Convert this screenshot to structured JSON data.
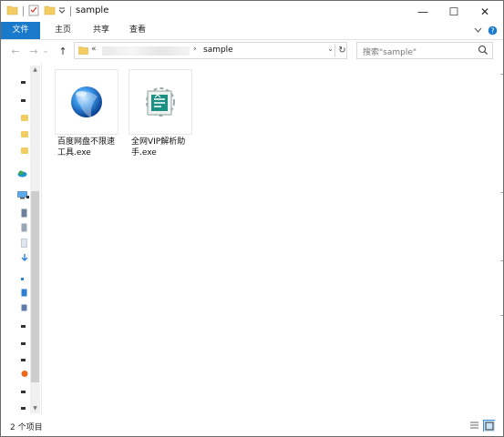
{
  "window": {
    "title": "sample",
    "controls": {
      "minimize": "—",
      "maximize": "☐",
      "close": "✕"
    }
  },
  "ribbon": {
    "tabs": [
      {
        "label": "文件",
        "selected": true
      },
      {
        "label": "主页"
      },
      {
        "label": "共享"
      },
      {
        "label": "查看"
      }
    ],
    "expand_icon": "chevron-down-icon",
    "help_icon": "help-icon"
  },
  "navigation": {
    "back": "←",
    "forward": "→",
    "recent": "⌄",
    "up": "↑"
  },
  "address": {
    "prefix": "«",
    "separator": "›",
    "current": "sample",
    "dropdown": "⌄",
    "refresh": "↻"
  },
  "search": {
    "placeholder": "搜索\"sample\""
  },
  "files": [
    {
      "name": "百度网盘不限速工具.exe",
      "icon": "blue-orb-app-icon"
    },
    {
      "name": "全网VIP解析助手.exe",
      "icon": "green-gear-app-icon"
    }
  ],
  "status": {
    "item_count": "2 个项目"
  },
  "colors": {
    "accent": "#1979ca",
    "folder": "#f3cd62",
    "border": "#6b6b6b"
  }
}
